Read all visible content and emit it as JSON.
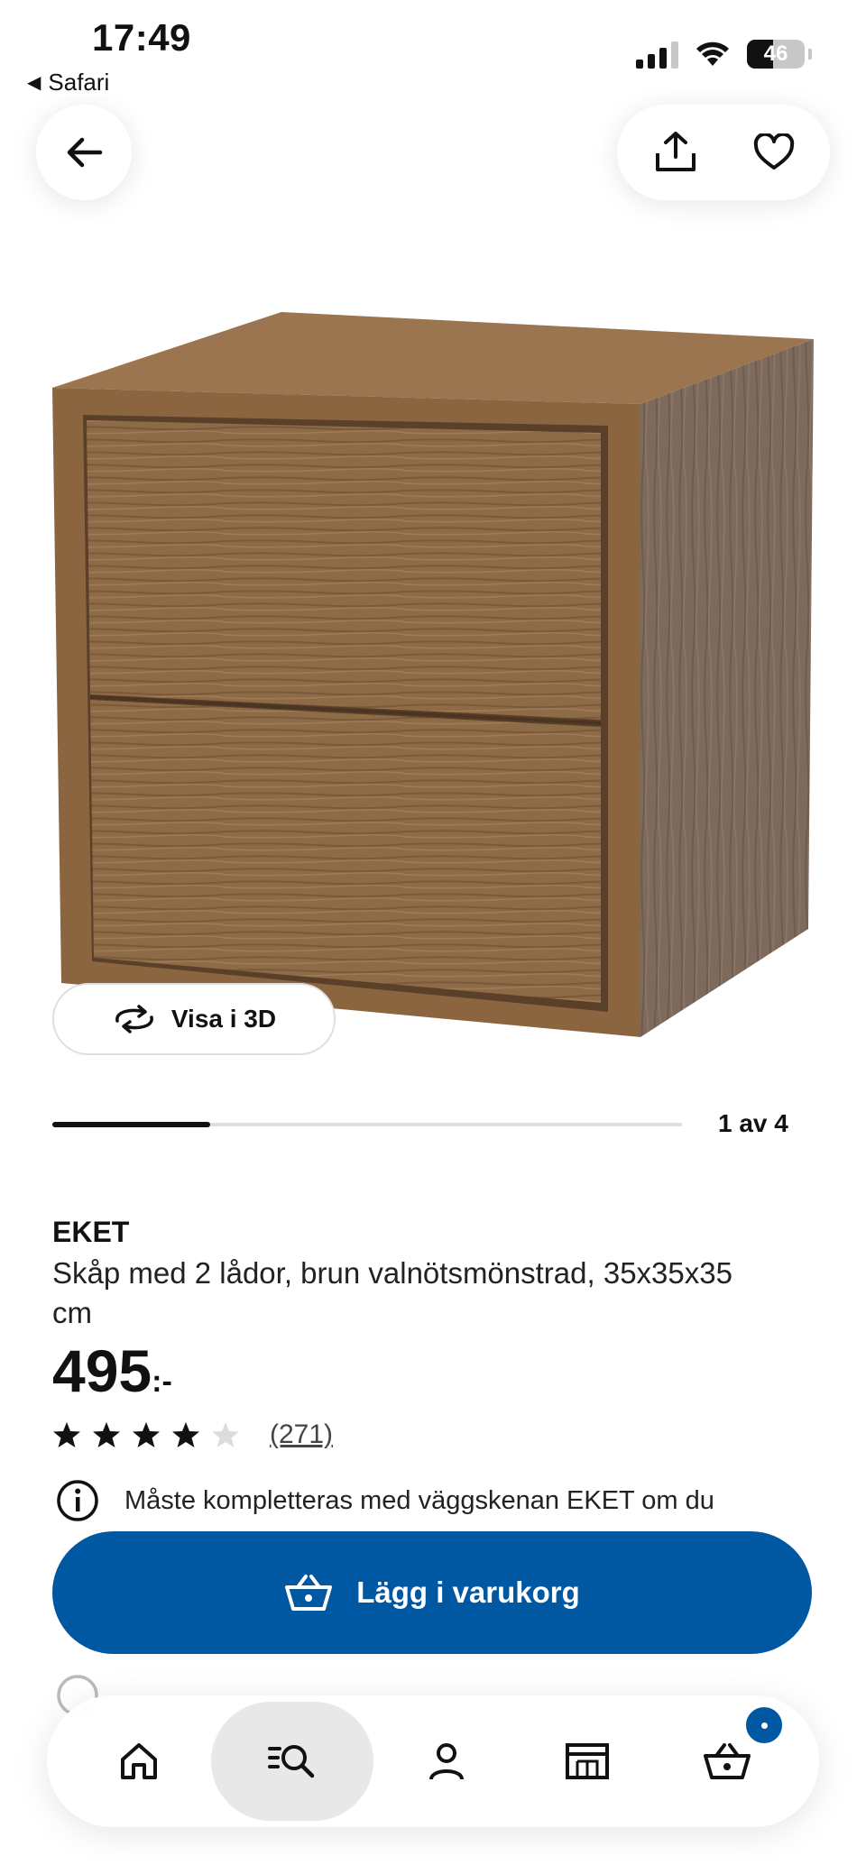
{
  "status_bar": {
    "time": "17:49",
    "back_app": "Safari",
    "battery": "46"
  },
  "product": {
    "name": "EKET",
    "description": "Skåp med 2 lådor, brun valnötsmönstrad, 35x35x35 cm",
    "price": "495",
    "price_suffix": ":-",
    "rating": 4,
    "rating_max": 5,
    "review_count": "(271)",
    "view3d_label": "Visa i 3D",
    "gallery": {
      "current": 1,
      "total": 4,
      "label": "1 av 4",
      "progress": 0.25
    }
  },
  "notices": {
    "wall_rail": "Måste kompletteras med väggskenan EKET om du"
  },
  "cart_button": {
    "label": "Lägg i varukorg"
  },
  "icons": {
    "back": "arrow-left-icon",
    "share": "share-icon",
    "favorite": "heart-icon",
    "rotate": "rotate-3d-icon",
    "info": "info-icon",
    "basket": "basket-icon",
    "home": "home-icon",
    "search": "search-list-icon",
    "profile": "user-icon",
    "store": "store-icon",
    "cart": "cart-icon"
  },
  "colors": {
    "accent": "#0058a3",
    "wood": "#8a6845"
  }
}
